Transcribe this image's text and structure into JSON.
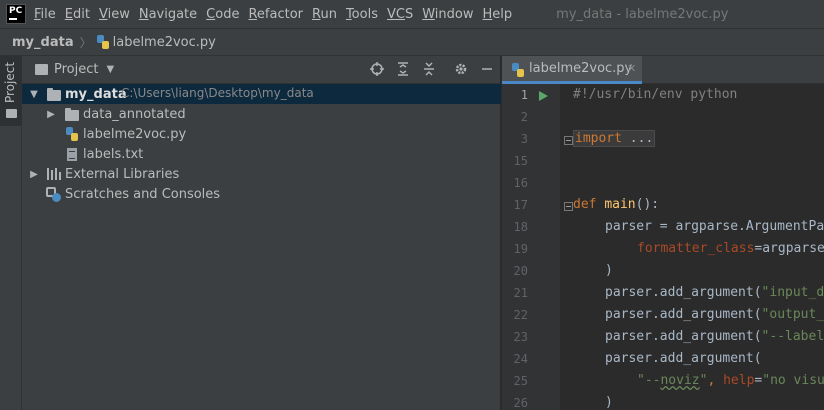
{
  "app": {
    "logo_text": "PC",
    "window_title": "my_data - labelme2voc.py",
    "menu": [
      {
        "mn": "F",
        "rest": "ile"
      },
      {
        "mn": "E",
        "rest": "dit"
      },
      {
        "mn": "V",
        "rest": "iew"
      },
      {
        "mn": "N",
        "rest": "avigate"
      },
      {
        "mn": "C",
        "rest": "ode"
      },
      {
        "mn": "R",
        "rest": "efactor"
      },
      {
        "mn": "R",
        "rest": "un"
      },
      {
        "mn": "T",
        "rest": "ools"
      },
      {
        "mn": "VC",
        "rest": "S"
      },
      {
        "mn": "W",
        "rest": "indow"
      },
      {
        "mn": "H",
        "rest": "elp"
      }
    ]
  },
  "breadcrumb": {
    "project": "my_data",
    "separator": "〉",
    "file": "labelme2voc.py"
  },
  "left_stripe": {
    "label": "Project"
  },
  "project_panel": {
    "title": "Project",
    "tree": {
      "root_name": "my_data",
      "root_path": "C:\\Users\\liang\\Desktop\\my_data",
      "folder": "data_annotated",
      "file_py": "labelme2voc.py",
      "file_txt": "labels.txt",
      "external": "External Libraries",
      "scratches": "Scratches and Consoles"
    }
  },
  "editor": {
    "tab_label": "labelme2voc.py",
    "line_numbers": [
      "1",
      "2",
      "3",
      "15",
      "16",
      "17",
      "18",
      "19",
      "20",
      "21",
      "22",
      "23",
      "24",
      "25",
      "26"
    ],
    "code": {
      "shebang": "#!/usr/bin/env python",
      "import_kw": "import",
      "import_fold": "...",
      "def_kw": "def",
      "main_name": "main",
      "main_rest": "():",
      "l18": "parser = argparse.ArgumentPa",
      "l19_param": "formatter_class",
      "l19_rest": "=argparse",
      "l20": ")",
      "l21_a": "parser.add_argument(",
      "l21_s": "\"input_d",
      "l22_a": "parser.add_argument(",
      "l22_s": "\"output_",
      "l23_a": "parser.add_argument(",
      "l23_s": "\"--label",
      "l24": "parser.add_argument(",
      "l25_s1a": "\"--",
      "l25_s1b": "noviz",
      "l25_s1c": "\"",
      "l25_comma": ", ",
      "l25_param": "help",
      "l25_eq": "=",
      "l25_s2": "\"no visu",
      "l26": ")"
    }
  },
  "colors": {
    "accent": "#4a88c7",
    "selection": "#0d293e",
    "run": "#59a869"
  }
}
